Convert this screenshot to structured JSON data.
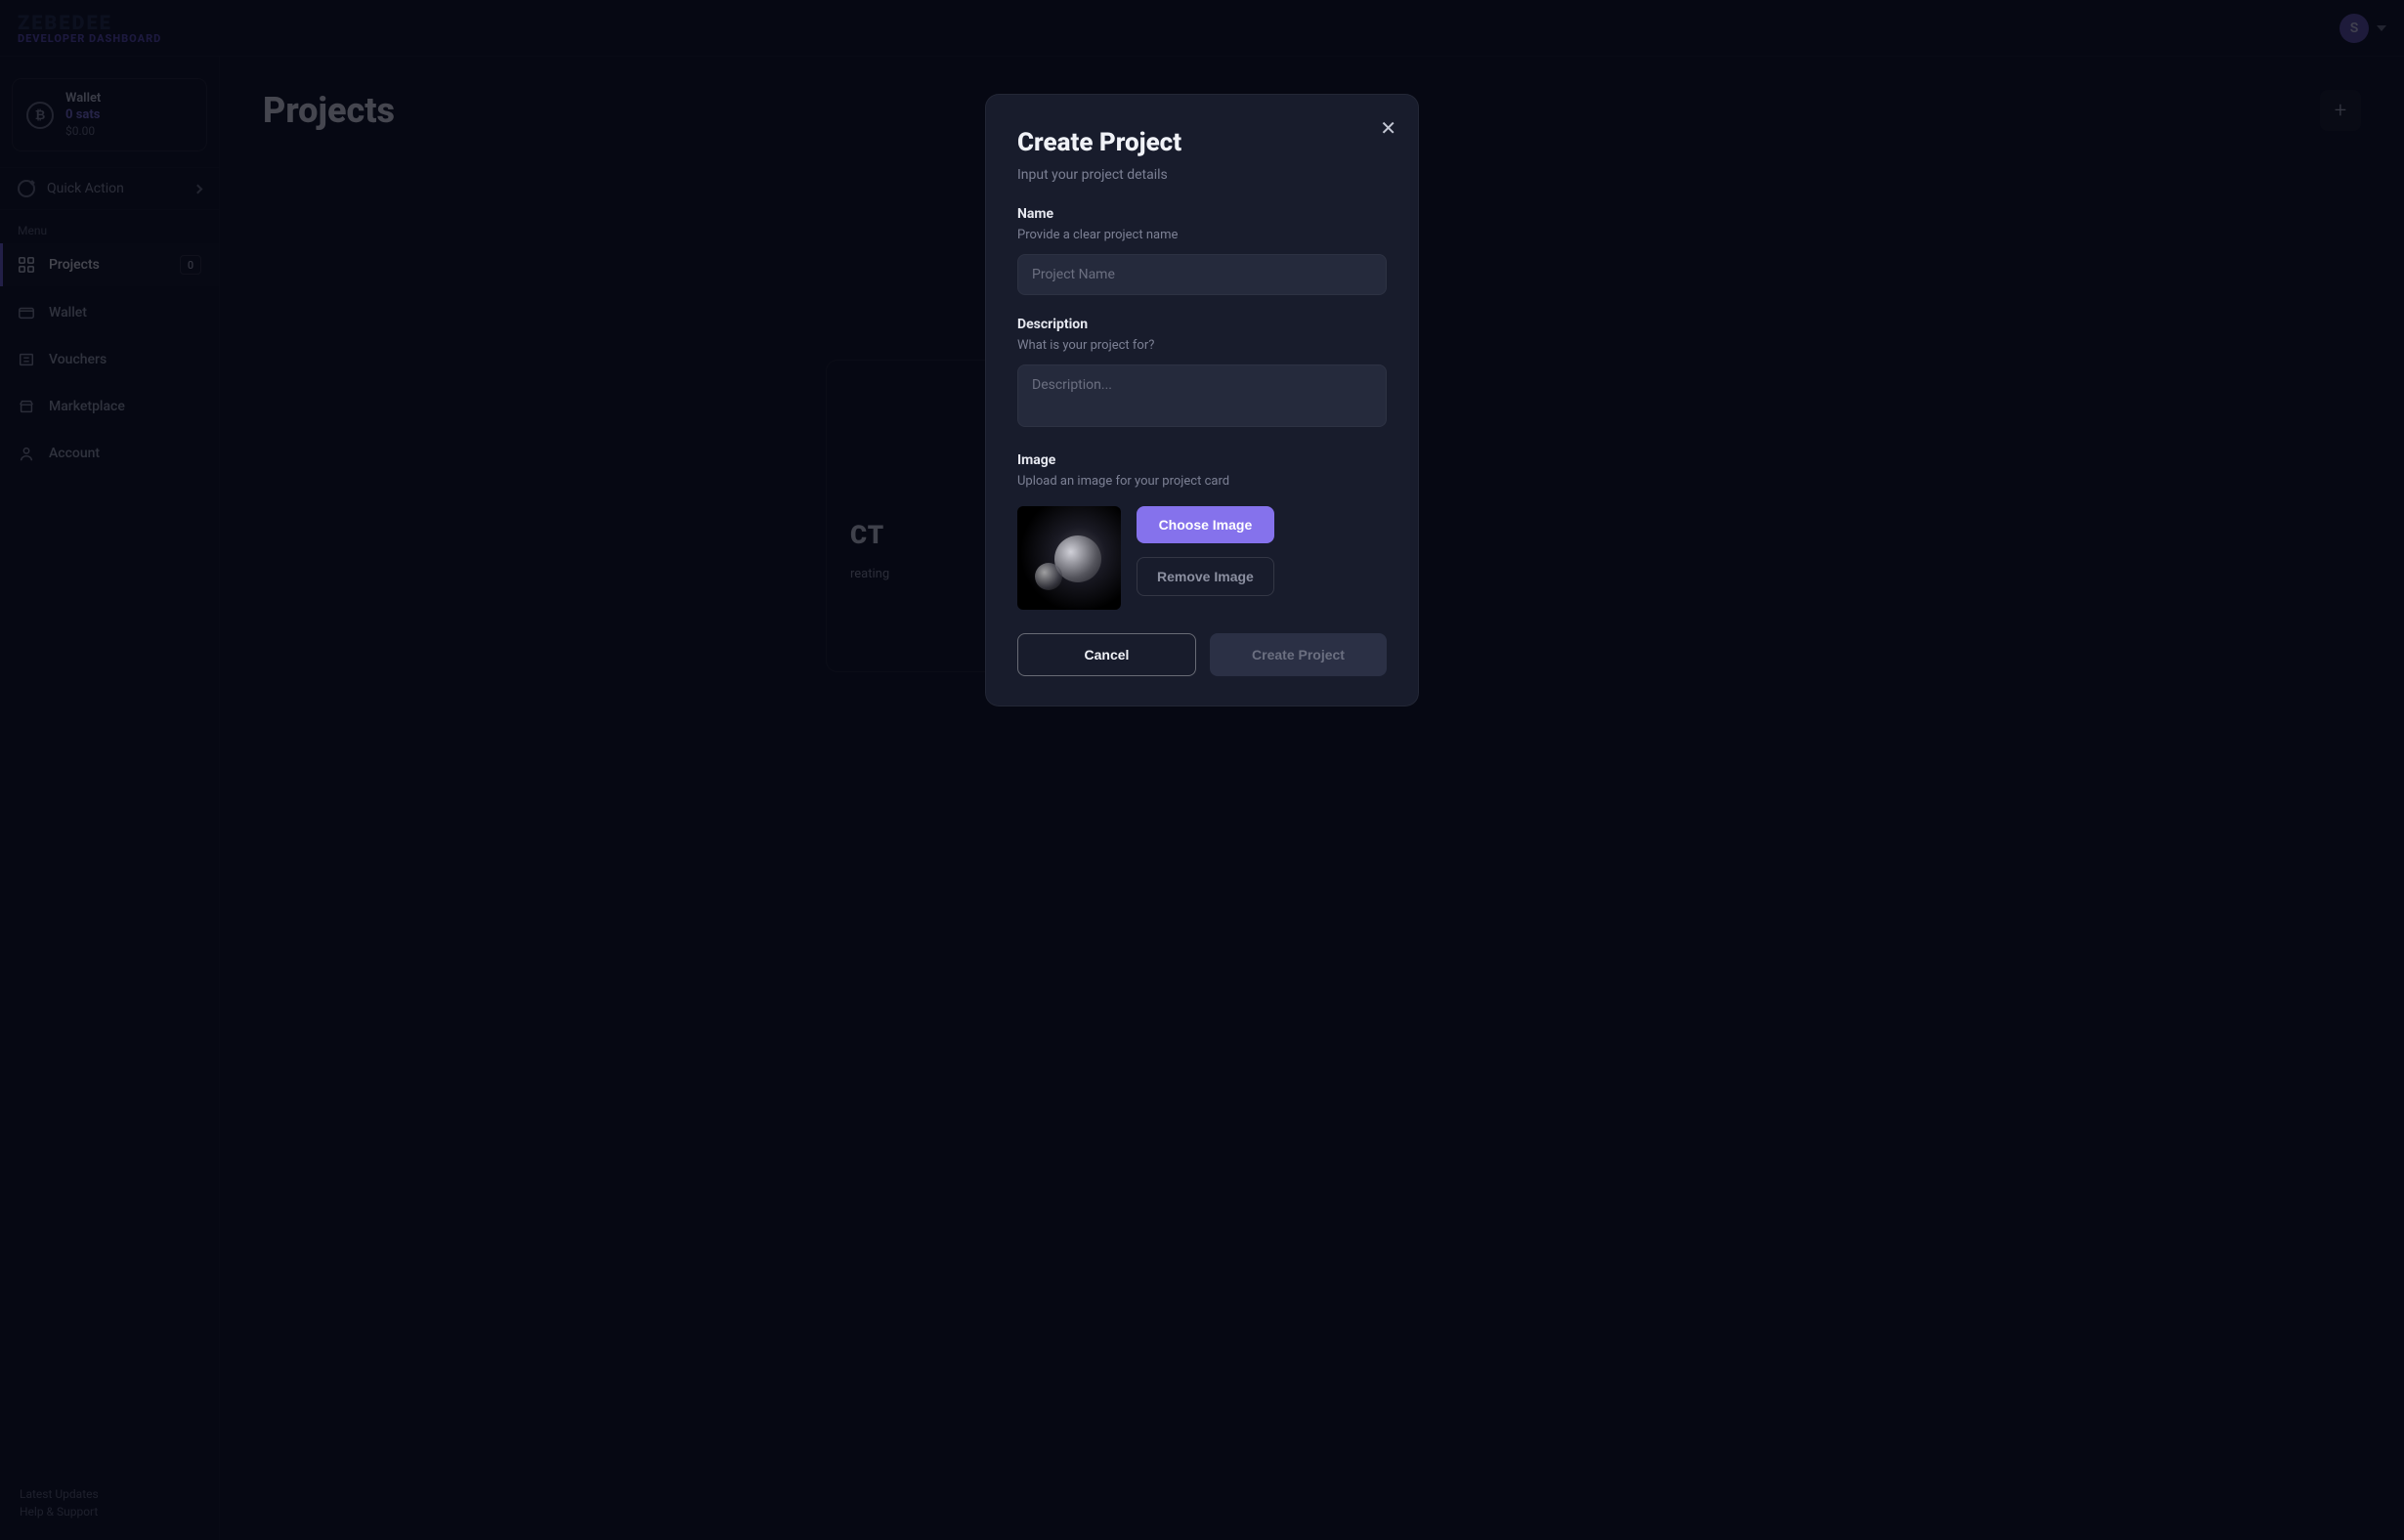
{
  "header": {
    "logo_main": "ZEBEDEE",
    "logo_sub": "DEVELOPER DASHBOARD",
    "avatar_letter": "S"
  },
  "sidebar": {
    "wallet": {
      "title": "Wallet",
      "sats": "0 sats",
      "fiat": "$0.00"
    },
    "quick_action_label": "Quick Action",
    "menu_heading": "Menu",
    "items": [
      {
        "label": "Projects",
        "badge": "0",
        "active": true
      },
      {
        "label": "Wallet"
      },
      {
        "label": "Vouchers"
      },
      {
        "label": "Marketplace"
      },
      {
        "label": "Account"
      }
    ],
    "footer": {
      "updates": "Latest Updates",
      "help": "Help & Support"
    }
  },
  "main": {
    "title": "Projects",
    "bg_card_title_suffix": "CT",
    "bg_card_line1_suffix": "reating",
    "bg_card_line2_suffix": ""
  },
  "modal": {
    "title": "Create Project",
    "subtitle": "Input your project details",
    "name_label": "Name",
    "name_hint": "Provide a clear project name",
    "name_placeholder": "Project Name",
    "desc_label": "Description",
    "desc_hint": "What is your project for?",
    "desc_placeholder": "Description...",
    "image_label": "Image",
    "image_hint": "Upload an image for your project card",
    "choose_image": "Choose Image",
    "remove_image": "Remove Image",
    "cancel": "Cancel",
    "create": "Create Project"
  }
}
